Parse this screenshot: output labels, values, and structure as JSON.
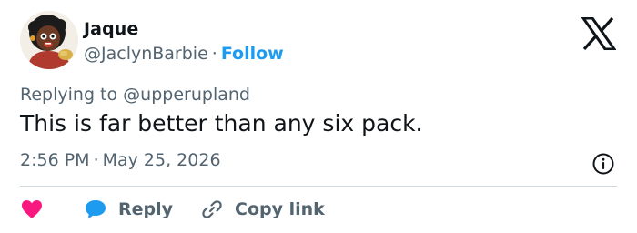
{
  "user": {
    "display_name": "Jaque",
    "handle": "@JaclynBarbie",
    "separator": "·",
    "follow_label": "Follow"
  },
  "reply_context": {
    "prefix": "Replying to",
    "mention": "@upperupland"
  },
  "tweet": {
    "text": "This is far better than any six pack.",
    "time": "2:56 PM",
    "separator": "·",
    "date": "May 25, 2026"
  },
  "actions": {
    "reply_label": "Reply",
    "copy_link_label": "Copy link"
  },
  "icons": {
    "brand": "x-logo-icon",
    "info": "info-icon",
    "like": "heart-icon",
    "reply": "reply-bubble-icon",
    "copy": "link-icon"
  },
  "colors": {
    "text": "#0f1419",
    "secondary": "#536471",
    "accent": "#1d9bf0",
    "like": "#f91880",
    "divider": "#cfd9de"
  }
}
